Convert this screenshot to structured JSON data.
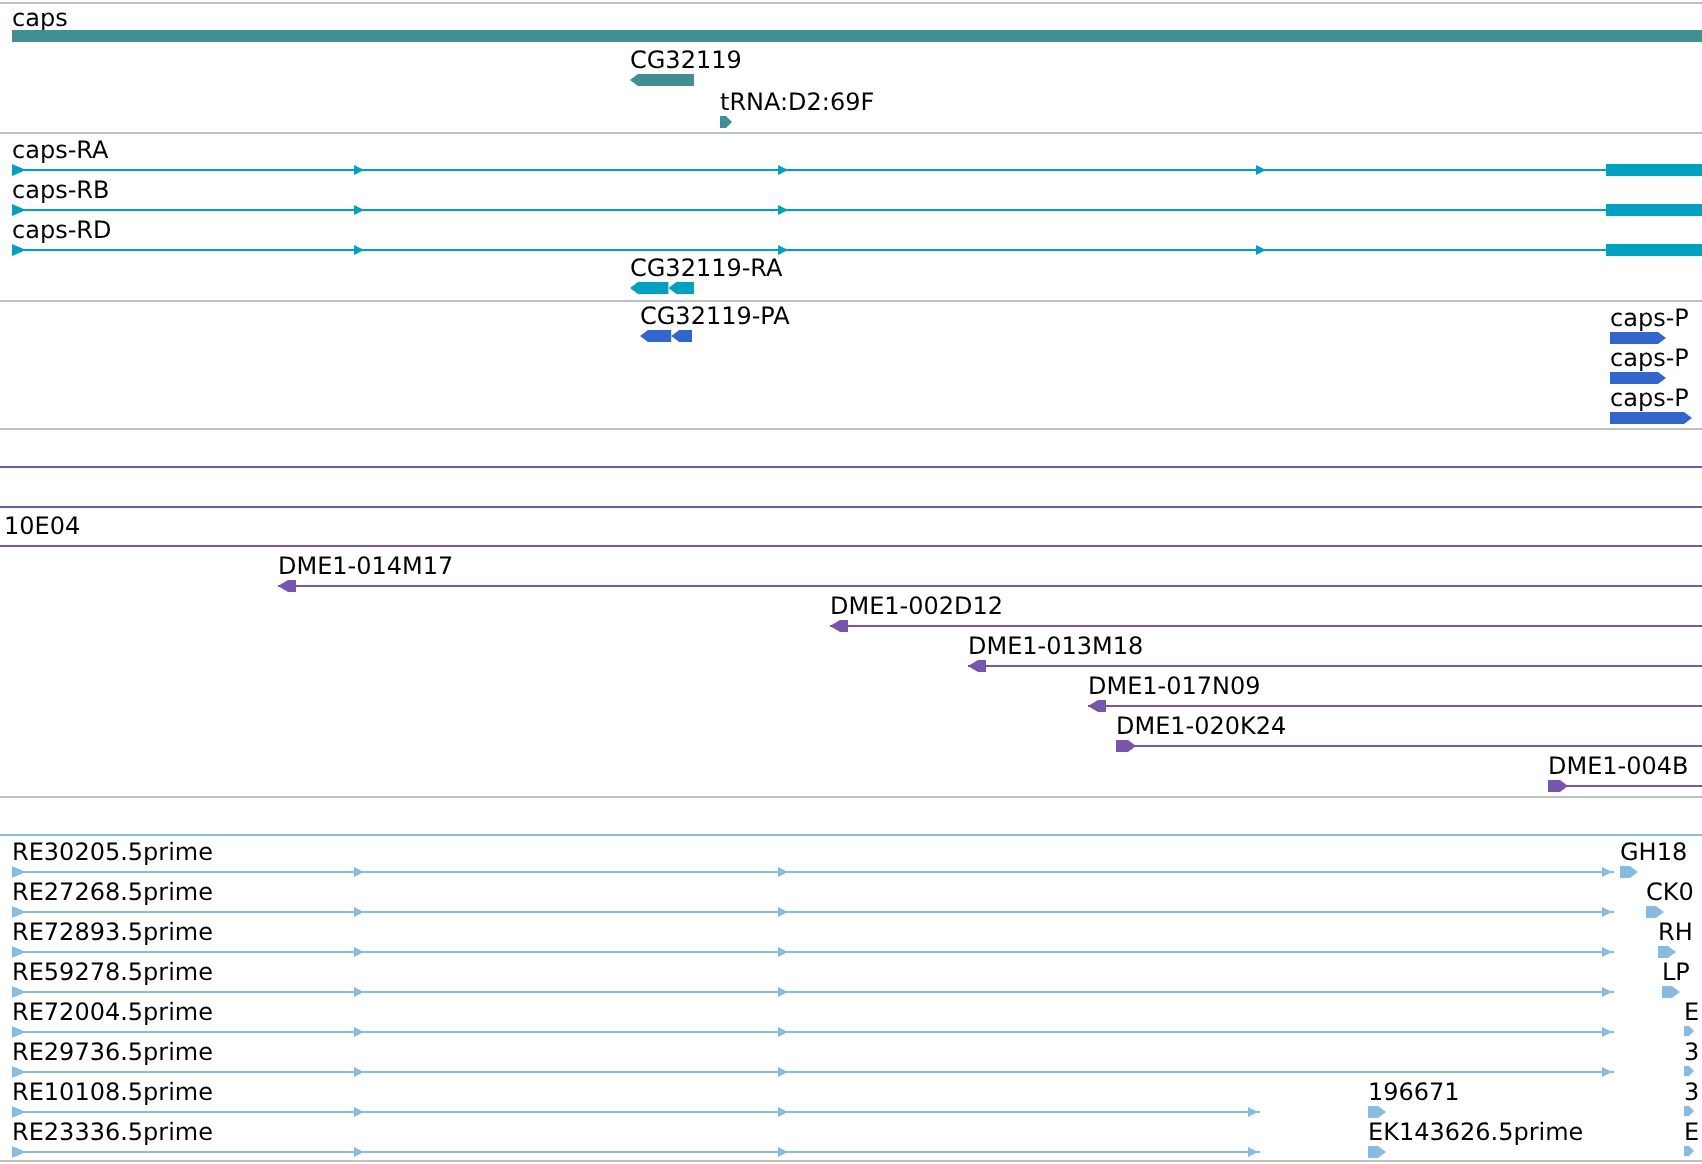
{
  "tracks": [
    {
      "kind": "gene",
      "features": [
        {
          "label": "caps",
          "reverse": false
        },
        {
          "label": "CG32119",
          "reverse": true
        },
        {
          "label": "tRNA:D2:69F",
          "reverse": false
        }
      ]
    },
    {
      "kind": "transcript",
      "features": [
        {
          "label": "caps-RA",
          "reverse": false
        },
        {
          "label": "caps-RB",
          "reverse": false
        },
        {
          "label": "caps-RD",
          "reverse": false
        },
        {
          "label": "CG32119-RA",
          "reverse": true
        }
      ]
    },
    {
      "kind": "protein",
      "features": [
        {
          "label": "CG32119-PA",
          "reverse": true
        },
        {
          "label": "caps-P",
          "reverse": false
        },
        {
          "label": "caps-P",
          "reverse": false
        },
        {
          "label": "caps-P",
          "reverse": false
        }
      ]
    },
    {
      "kind": "clone",
      "features": [
        {
          "label": "10E04"
        },
        {
          "label": "DME1-014M17",
          "reverse": true
        },
        {
          "label": "DME1-002D12",
          "reverse": true
        },
        {
          "label": "DME1-013M18",
          "reverse": true
        },
        {
          "label": "DME1-017N09",
          "reverse": true
        },
        {
          "label": "DME1-020K24",
          "reverse": false
        },
        {
          "label": "DME1-004B",
          "reverse": false
        }
      ]
    },
    {
      "kind": "est",
      "features": [
        {
          "label": "RE30205.5prime",
          "reverse": false
        },
        {
          "label": "RE27268.5prime",
          "reverse": false
        },
        {
          "label": "RE72893.5prime",
          "reverse": false
        },
        {
          "label": "RE59278.5prime",
          "reverse": false
        },
        {
          "label": "RE72004.5prime",
          "reverse": false
        },
        {
          "label": "RE29736.5prime",
          "reverse": false
        },
        {
          "label": "RE10108.5prime",
          "reverse": false
        },
        {
          "label": "RE23336.5prime",
          "reverse": false
        },
        {
          "label": "GH18",
          "reverse": false
        },
        {
          "label": "CK0",
          "reverse": false
        },
        {
          "label": "RH",
          "reverse": false
        },
        {
          "label": "LP",
          "reverse": false
        },
        {
          "label": "E",
          "reverse": false
        },
        {
          "label": "3",
          "reverse": false
        },
        {
          "label": "3",
          "reverse": false
        },
        {
          "label": "E",
          "reverse": false
        },
        {
          "label": "196671",
          "reverse": false
        },
        {
          "label": "EK143626.5prime",
          "reverse": false
        }
      ]
    }
  ]
}
